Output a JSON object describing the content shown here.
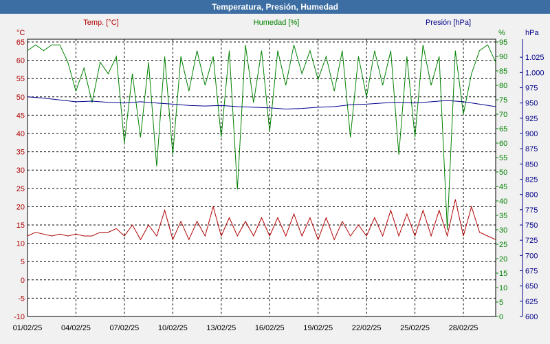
{
  "title": "Temperatura, Presión, Humedad",
  "colors": {
    "background": "#f1f1f1",
    "title_bar": "#3d6ea3",
    "temperature": "#b00000",
    "humidity": "#008000",
    "pressure": "#00008b"
  },
  "chart_data": {
    "type": "line",
    "title": "Temperatura, Presión, Humedad",
    "grid": true,
    "x_ticks": [
      "01/02/25",
      "04/02/25",
      "07/02/25",
      "10/02/25",
      "13/02/25",
      "16/02/25",
      "19/02/25",
      "22/02/25",
      "25/02/25",
      "28/02/25"
    ],
    "xlim": [
      "01/02/25",
      "02/03/25"
    ],
    "axes": {
      "temperature": {
        "label": "Temp. [°C]",
        "unit": "°C",
        "ylim": [
          -10,
          65
        ],
        "ticks": [
          "65",
          "60",
          "55",
          "50",
          "45",
          "40",
          "35",
          "30",
          "25",
          "20",
          "15",
          "10",
          "5",
          "0",
          "-5",
          "-10"
        ]
      },
      "humidity": {
        "label": "Humedad [%]",
        "unit": "%",
        "ylim": [
          0,
          95
        ],
        "ticks": [
          "95",
          "90",
          "85",
          "80",
          "75",
          "70",
          "65",
          "60",
          "55",
          "50",
          "45",
          "40",
          "35",
          "30",
          "25",
          "20",
          "15",
          "10",
          "5",
          "0"
        ]
      },
      "pressure": {
        "label": "Presión [hPa]",
        "unit": "hPa",
        "ylim": [
          600,
          1050
        ],
        "ticks": [
          "1.025",
          "1.000",
          "975",
          "950",
          "925",
          "900",
          "875",
          "850",
          "825",
          "800",
          "775",
          "750",
          "725",
          "700",
          "675",
          "650",
          "625",
          "600"
        ]
      }
    },
    "series": [
      {
        "name": "Temp. [°C]",
        "axis": "temperature",
        "x_days": [
          0,
          0.5,
          1,
          1.5,
          2,
          2.5,
          3,
          3.5,
          4,
          4.5,
          5,
          5.5,
          6,
          6.5,
          7,
          7.5,
          8,
          8.5,
          9,
          9.5,
          10,
          10.5,
          11,
          11.5,
          12,
          12.5,
          13,
          13.5,
          14,
          14.5,
          15,
          15.5,
          16,
          16.5,
          17,
          17.5,
          18,
          18.5,
          19,
          19.5,
          20,
          20.5,
          21,
          21.5,
          22,
          22.5,
          23,
          23.5,
          24,
          24.5,
          25,
          25.5,
          26,
          26.5,
          27,
          27.5,
          28,
          28.5,
          29
        ],
        "values": [
          12,
          13,
          12.5,
          12,
          12.5,
          12,
          12.5,
          12,
          12,
          13,
          13,
          14,
          12,
          15,
          11,
          15,
          12,
          19,
          11,
          16,
          11,
          16,
          12,
          20,
          12,
          17,
          12,
          16,
          12,
          17,
          12,
          17,
          12,
          18,
          12,
          17,
          11,
          17,
          11,
          16,
          12,
          15,
          12,
          17,
          12,
          19,
          12,
          18,
          12,
          19,
          12,
          19,
          12,
          22,
          12,
          20,
          13,
          12,
          11
        ]
      },
      {
        "name": "Humedad [%]",
        "axis": "humidity",
        "x_days": [
          0,
          0.5,
          1,
          1.5,
          2,
          2.5,
          3,
          3.5,
          4,
          4.5,
          5,
          5.5,
          6,
          6.5,
          7,
          7.5,
          8,
          8.5,
          9,
          9.5,
          10,
          10.5,
          11,
          11.5,
          12,
          12.5,
          13,
          13.5,
          14,
          14.5,
          15,
          15.5,
          16,
          16.5,
          17,
          17.5,
          18,
          18.5,
          19,
          19.5,
          20,
          20.5,
          21,
          21.5,
          22,
          22.5,
          23,
          23.5,
          24,
          24.5,
          25,
          25.5,
          26,
          26.5,
          27,
          27.5,
          28,
          28.5,
          29
        ],
        "values": [
          92,
          94,
          92,
          94,
          94,
          88,
          78,
          86,
          74,
          88,
          84,
          90,
          60,
          84,
          62,
          88,
          52,
          90,
          56,
          90,
          78,
          92,
          80,
          90,
          62,
          92,
          44,
          94,
          74,
          92,
          64,
          92,
          80,
          94,
          84,
          92,
          82,
          90,
          78,
          92,
          62,
          90,
          76,
          92,
          80,
          92,
          56,
          90,
          62,
          94,
          80,
          90,
          30,
          92,
          70,
          84,
          92,
          94,
          88
        ]
      },
      {
        "name": "Presión [hPa]",
        "axis": "pressure",
        "x_days": [
          0,
          1,
          2,
          3,
          4,
          5,
          6,
          7,
          8,
          9,
          10,
          11,
          12,
          13,
          14,
          15,
          16,
          17,
          18,
          19,
          20,
          21,
          22,
          23,
          24,
          25,
          26,
          27,
          28,
          29
        ],
        "values": [
          960,
          958,
          955,
          952,
          953,
          951,
          950,
          952,
          950,
          948,
          946,
          945,
          946,
          944,
          943,
          942,
          940,
          941,
          943,
          944,
          947,
          948,
          950,
          951,
          950,
          952,
          954,
          952,
          948,
          944
        ]
      }
    ]
  }
}
